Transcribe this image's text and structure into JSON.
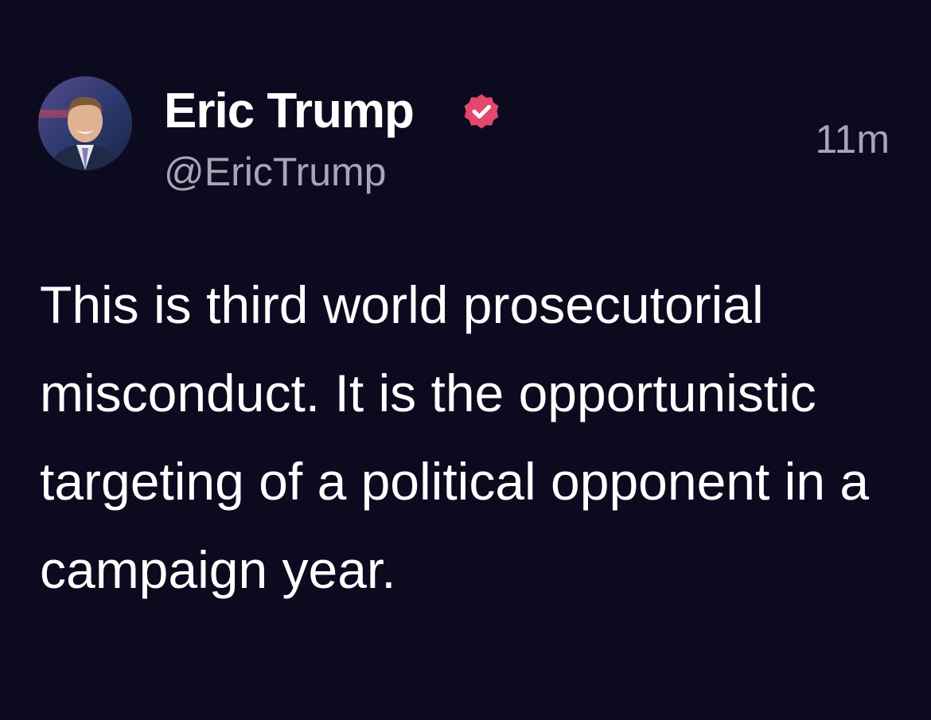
{
  "post": {
    "author": {
      "display_name": "Eric Trump",
      "handle": "@EricTrump",
      "verified_icon": "verified-badge-icon",
      "verified_color": "#e5486d"
    },
    "timestamp": "11m",
    "text": "This is third world prosecutorial misconduct. It is the opportunistic targeting of a political opponent in a campaign year."
  },
  "colors": {
    "background": "#0c0a1e",
    "primary_text": "#ffffff",
    "secondary_text": "#a8a6b6"
  }
}
